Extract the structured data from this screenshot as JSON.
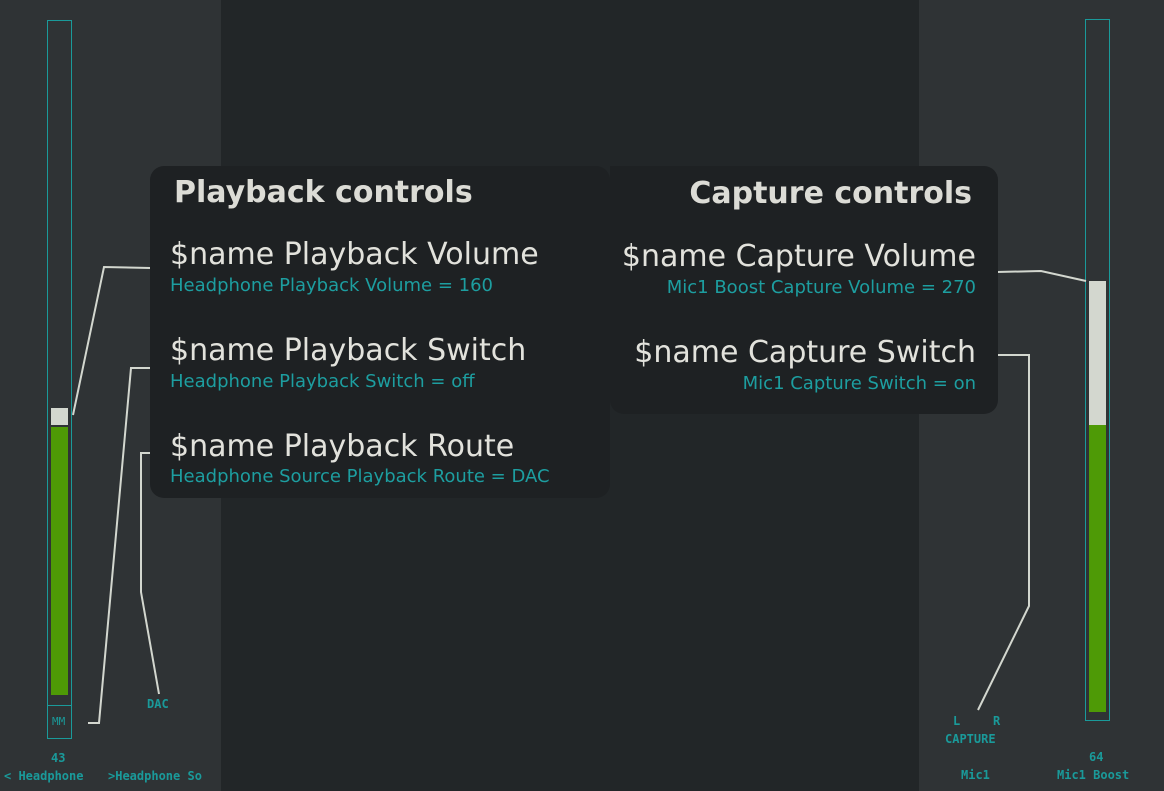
{
  "colors": {
    "accent": "#1a9a9a",
    "level_fill": "#4e9a06",
    "level_peak": "#d3d7cf",
    "panel_bg": "#1e2123",
    "pane_bg": "#2f3335"
  },
  "mixer_left": {
    "headphone_channel": {
      "level": 43,
      "level_fraction": 0.43,
      "mute_label": "MM",
      "value_label": "43",
      "name_label": "< Headphone"
    },
    "headphone_source": {
      "value_label": "DAC",
      "name_label": ">Headphone So"
    }
  },
  "mixer_right": {
    "mic1": {
      "capture_left_label": "L",
      "capture_right_label": "R",
      "capture_label": "CAPTURE",
      "name_label": "Mic1"
    },
    "mic1_boost": {
      "level": 64,
      "level_fraction": 0.64,
      "value_label": "64",
      "name_label": "Mic1 Boost"
    }
  },
  "playback": {
    "title": "Playback controls",
    "controls": [
      {
        "name": "$name Playback Volume",
        "value": "Headphone Playback Volume = 160"
      },
      {
        "name": "$name Playback Switch",
        "value": "Headphone Playback Switch = off"
      },
      {
        "name": "$name Playback Route",
        "value": "Headphone Source Playback Route = DAC"
      }
    ]
  },
  "capture": {
    "title": "Capture controls",
    "controls": [
      {
        "name": "$name Capture Volume",
        "value": "Mic1 Boost Capture Volume = 270"
      },
      {
        "name": "$name Capture Switch",
        "value": "Mic1 Capture Switch = on"
      }
    ]
  }
}
